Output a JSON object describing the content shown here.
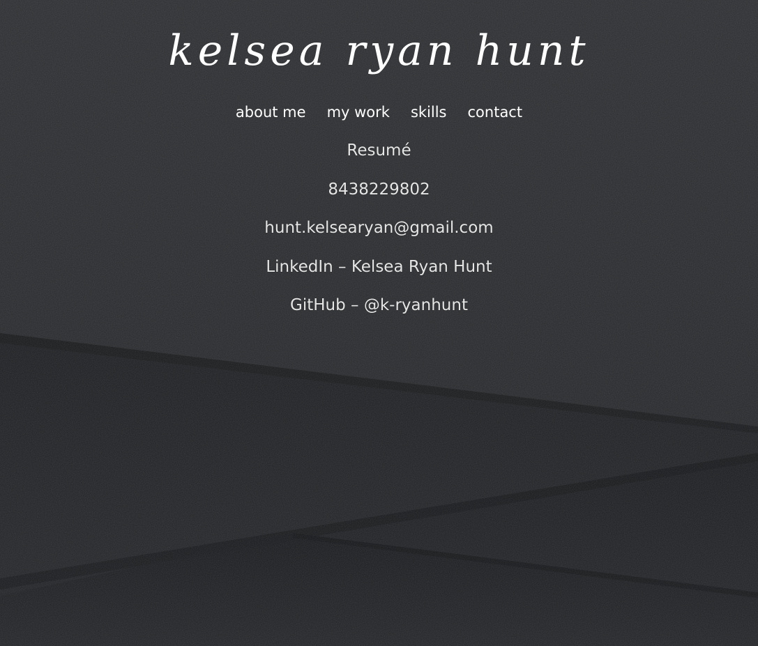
{
  "site": {
    "logo_text": "kelsea ryan hunt"
  },
  "nav": {
    "items": [
      {
        "label": "about me"
      },
      {
        "label": "my work"
      },
      {
        "label": "skills"
      },
      {
        "label": "contact"
      }
    ]
  },
  "contact": {
    "resume": "Resumé",
    "phone": "8438229802",
    "email": "hunt.kelsearyan@gmail.com",
    "linkedin": "LinkedIn – Kelsea Ryan Hunt",
    "github": "GitHub – @k-ryanhunt"
  },
  "colors": {
    "background": "#26282b",
    "text": "#ffffff"
  }
}
